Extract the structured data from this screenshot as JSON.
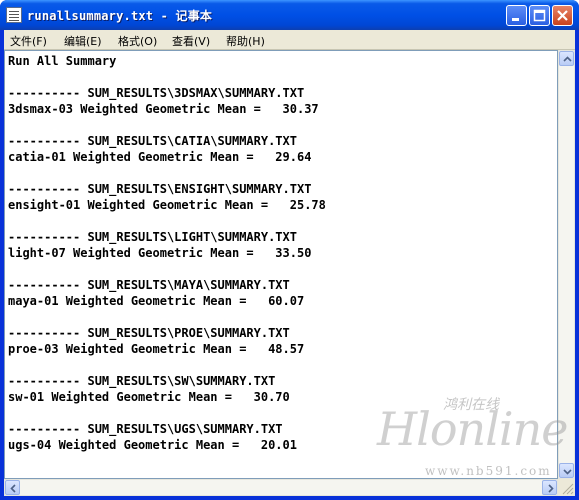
{
  "window": {
    "title": "runallsummary.txt - 记事本",
    "minimize_icon": "minimize-icon",
    "maximize_icon": "maximize-icon",
    "close_icon": "close-icon"
  },
  "menu": {
    "items": [
      {
        "label": "文件(F)"
      },
      {
        "label": "编辑(E)"
      },
      {
        "label": "格式(O)"
      },
      {
        "label": "查看(V)"
      },
      {
        "label": "帮助(H)"
      }
    ]
  },
  "document": {
    "lines": [
      "Run All Summary",
      "",
      "---------- SUM_RESULTS\\3DSMAX\\SUMMARY.TXT",
      "3dsmax-03 Weighted Geometric Mean =   30.37",
      "",
      "---------- SUM_RESULTS\\CATIA\\SUMMARY.TXT",
      "catia-01 Weighted Geometric Mean =   29.64",
      "",
      "---------- SUM_RESULTS\\ENSIGHT\\SUMMARY.TXT",
      "ensight-01 Weighted Geometric Mean =   25.78",
      "",
      "---------- SUM_RESULTS\\LIGHT\\SUMMARY.TXT",
      "light-07 Weighted Geometric Mean =   33.50",
      "",
      "---------- SUM_RESULTS\\MAYA\\SUMMARY.TXT",
      "maya-01 Weighted Geometric Mean =   60.07",
      "",
      "---------- SUM_RESULTS\\PROE\\SUMMARY.TXT",
      "proe-03 Weighted Geometric Mean =   48.57",
      "",
      "---------- SUM_RESULTS\\SW\\SUMMARY.TXT",
      "sw-01 Weighted Geometric Mean =   30.70",
      "",
      "---------- SUM_RESULTS\\UGS\\SUMMARY.TXT",
      "ugs-04 Weighted Geometric Mean =   20.01"
    ]
  },
  "watermark": {
    "brand": "Hlonline",
    "chinese": "鸿利在线",
    "url": "www.nb591.com"
  }
}
